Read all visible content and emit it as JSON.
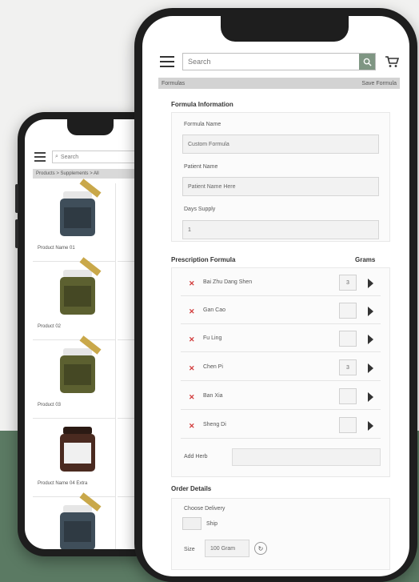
{
  "colors": {
    "background": "#f1f1f0",
    "green_band": "#5b7a63",
    "accent": "#7f9683",
    "delete": "#d23b3b"
  },
  "back_phone": {
    "search_placeholder": "Search",
    "breadcrumb": "Products > Supplements > All",
    "products": [
      {
        "caption": "Product Name 01",
        "color": "#3f4e5a"
      },
      {
        "caption": "Product 02",
        "color": "#5c6030"
      },
      {
        "caption": "Product 03",
        "color": "#5c6030"
      },
      {
        "caption": "Product Name 04 Extra",
        "color": "#4a2a20"
      },
      {
        "caption": "",
        "color": "#3f4e5a"
      }
    ]
  },
  "front_phone": {
    "search_placeholder": "Search",
    "breadcrumb_left": "Formulas",
    "breadcrumb_right": "Save Formula",
    "section_info_title": "Formula Information",
    "fields": [
      {
        "label": "Formula Name",
        "value": "Custom Formula"
      },
      {
        "label": "Patient Name",
        "value": "Patient Name Here"
      },
      {
        "label": "Days Supply",
        "value": "1"
      }
    ],
    "section_formula_title": "Prescription Formula",
    "section_formula_right": "Grams",
    "rx_items": [
      {
        "name": "Bai Zhu Dang Shen",
        "qty": "3"
      },
      {
        "name": "Gan Cao",
        "qty": ""
      },
      {
        "name": "Fu Ling",
        "qty": ""
      },
      {
        "name": "Chen Pi",
        "qty": "3"
      },
      {
        "name": "Ban Xia",
        "qty": ""
      },
      {
        "name": "Sheng Di",
        "qty": ""
      }
    ],
    "add_herb_label": "Add Herb",
    "section_order_title": "Order Details",
    "order_subtitle": "Choose Delivery",
    "option_label": "Ship",
    "size_label": "Size",
    "size_value": "100 Gram"
  }
}
